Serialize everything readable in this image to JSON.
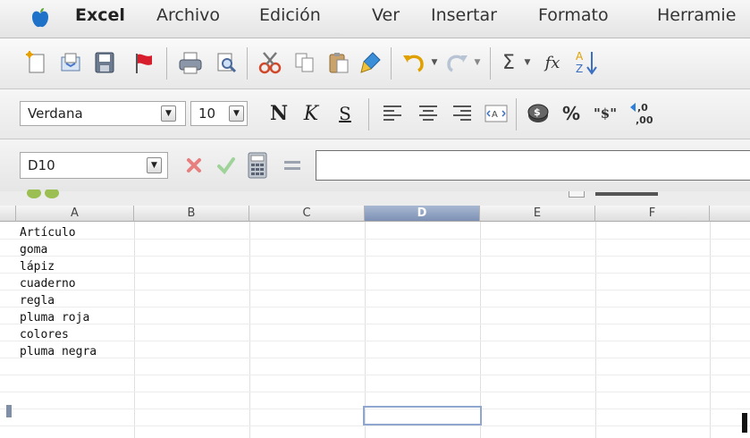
{
  "menubar": {
    "app_name": "Excel",
    "items": [
      "Archivo",
      "Edición",
      "Ver",
      "Insertar",
      "Formato",
      "Herramie"
    ]
  },
  "format_toolbar": {
    "font_name": "Verdana",
    "font_size": "10",
    "bold_label": "N",
    "italic_label": "K",
    "underline_label": "S",
    "percent_label": "%",
    "currency_label": "\"$\""
  },
  "standard_toolbar": {
    "sum_label": "Σ",
    "function_label": "fx"
  },
  "formula_bar": {
    "name_box": "D10",
    "formula_value": ""
  },
  "sheet": {
    "columns": [
      "A",
      "B",
      "C",
      "D",
      "E",
      "F"
    ],
    "selected_column": "D",
    "selected_cell": "D10",
    "column_a_values": [
      "Artículo",
      "goma",
      "lápiz",
      "cuaderno",
      "regla",
      "pluma roja",
      "colores",
      "pluma negra"
    ]
  }
}
